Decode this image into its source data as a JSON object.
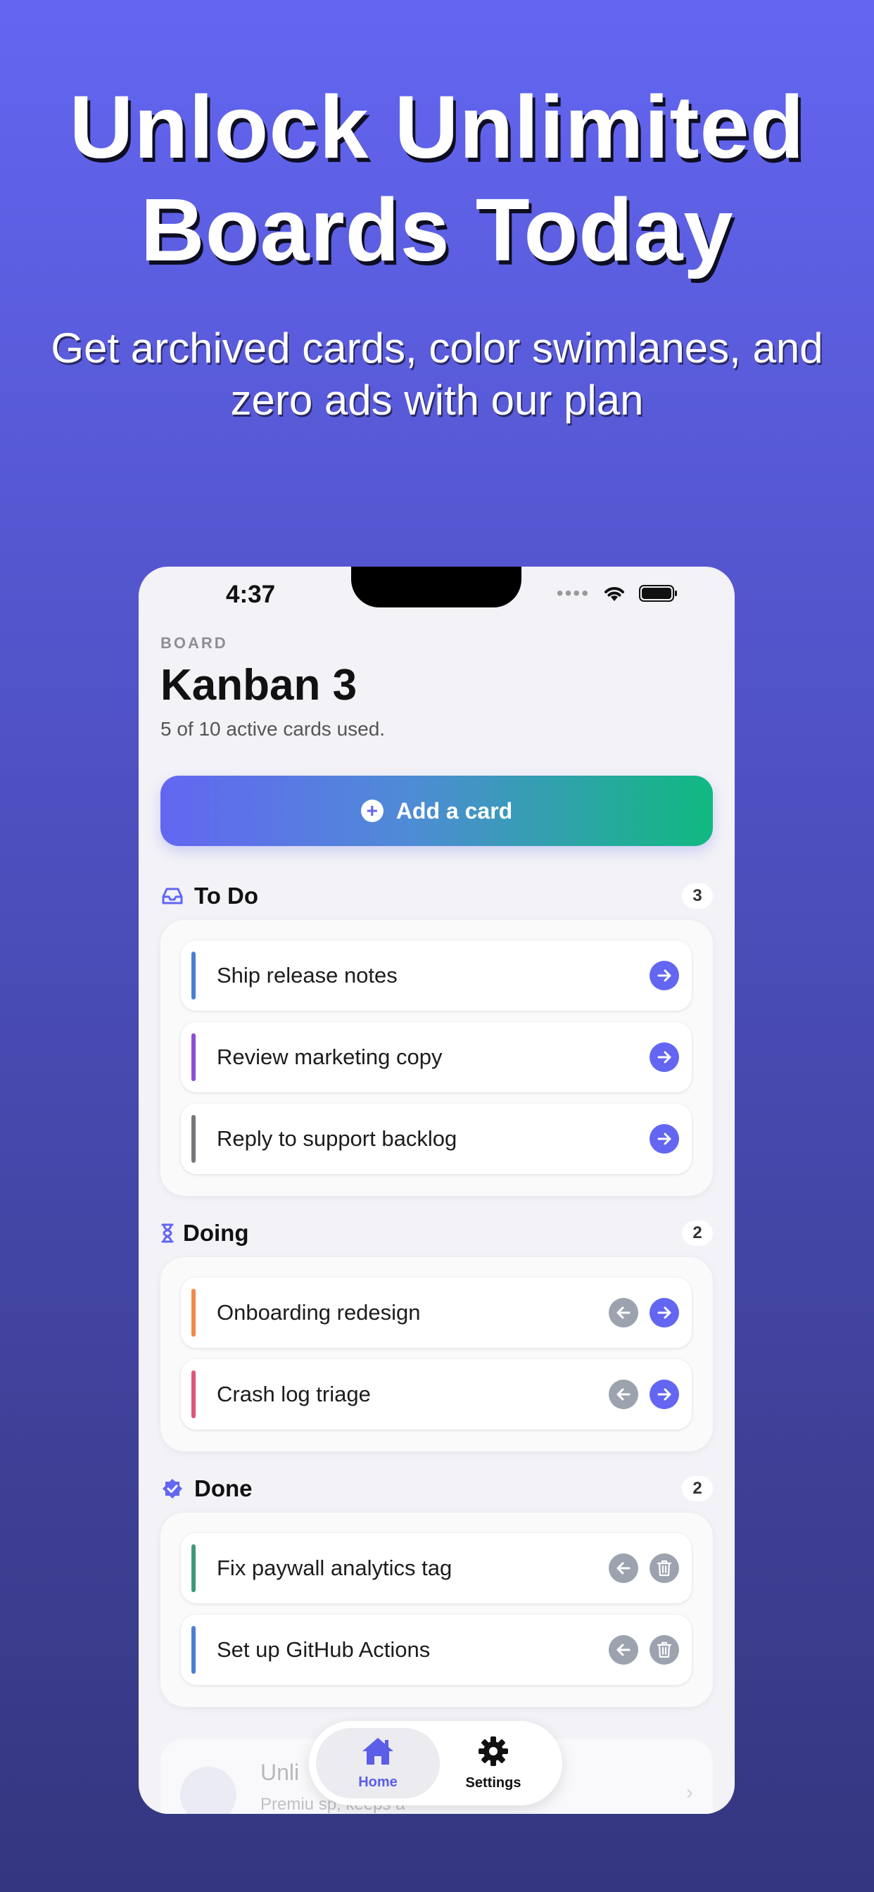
{
  "promo": {
    "headline_line1": "Unlock Unlimited",
    "headline_line2": "Boards Today",
    "subhead_line1": "Get archived cards, color swimlanes, and",
    "subhead_line2": "zero ads with our plan"
  },
  "status_bar": {
    "time": "4:37"
  },
  "board": {
    "label": "BOARD",
    "title": "Kanban 3",
    "usage": "5 of 10 active cards used.",
    "add_card_label": "Add a card"
  },
  "lanes": [
    {
      "title": "To Do",
      "count": "3",
      "icon": "inbox-icon",
      "cards": [
        {
          "text": "Ship release notes",
          "color": "#4a7fd4"
        },
        {
          "text": "Review marketing copy",
          "color": "#8b4fd9"
        },
        {
          "text": "Reply to support backlog",
          "color": "#77777c"
        }
      ]
    },
    {
      "title": "Doing",
      "count": "2",
      "icon": "hourglass-icon",
      "cards": [
        {
          "text": "Onboarding redesign",
          "color": "#f0894a"
        },
        {
          "text": "Crash log triage",
          "color": "#e05578"
        }
      ]
    },
    {
      "title": "Done",
      "count": "2",
      "icon": "checkmark-seal-icon",
      "cards": [
        {
          "text": "Fix paywall analytics tag",
          "color": "#3f9a78"
        },
        {
          "text": "Set up GitHub Actions",
          "color": "#4a7fd4"
        }
      ]
    }
  ],
  "upsell": {
    "title": "Unli",
    "subtitle": "Premiu                              sp, keeps a"
  },
  "tabs": {
    "home": "Home",
    "settings": "Settings"
  },
  "colors": {
    "accent": "#6366f1",
    "accent_green": "#10b981",
    "muted_button": "#9ca3af"
  }
}
